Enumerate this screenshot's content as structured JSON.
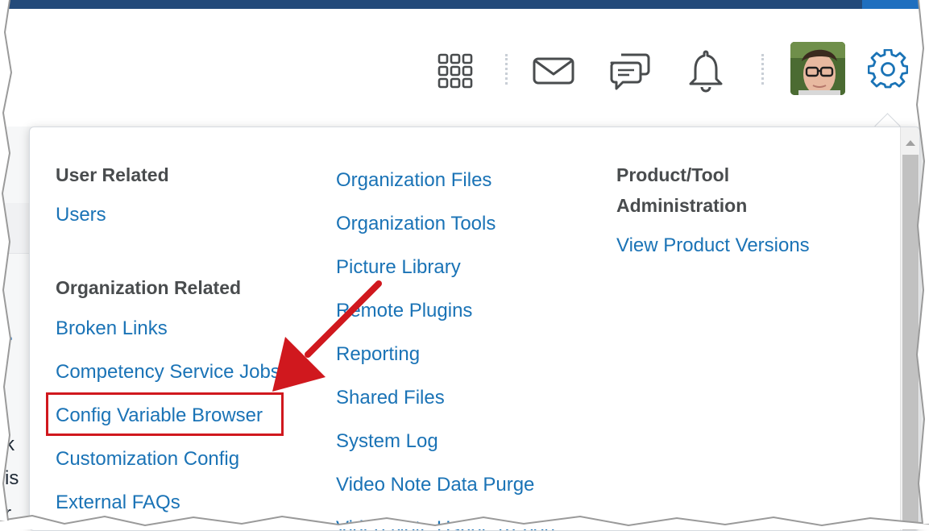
{
  "header": {
    "icons": {
      "grid": "grid-icon",
      "mail": "mail-icon",
      "chat": "chat-icon",
      "bell": "bell-icon",
      "gear": "gear-icon"
    },
    "accent_color": "#1a73b6"
  },
  "background": {
    "partial_texts": [
      "k",
      "is",
      "r"
    ]
  },
  "admin_menu": {
    "col1": {
      "user_heading": "User Related",
      "user_links": [
        "Users"
      ],
      "org_heading": "Organization Related",
      "org_links": [
        "Broken Links",
        "Competency Service Jobs",
        "Config Variable Browser",
        "Customization Config",
        "External FAQs"
      ]
    },
    "col2": {
      "links": [
        "Organization Files",
        "Organization Tools",
        "Picture Library",
        "Remote Plugins",
        "Reporting",
        "Shared Files",
        "System Log",
        "Video Note Data Purge",
        "Video Note Usage Report"
      ]
    },
    "col3": {
      "heading_line1": "Product/Tool",
      "heading_line2": "Administration",
      "links": [
        "View Product Versions"
      ]
    }
  },
  "annotation": {
    "highlight_color": "#d0181e",
    "highlighted_item": "Config Variable Browser"
  }
}
